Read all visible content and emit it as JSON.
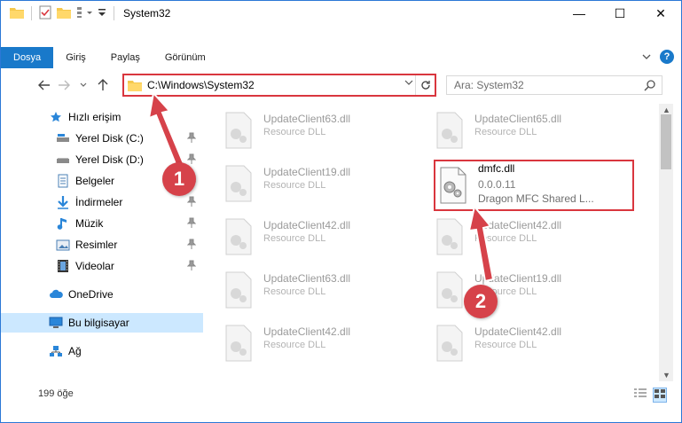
{
  "window": {
    "title": "System32",
    "controls": {
      "minimize": "—",
      "maximize": "☐",
      "close": "✕"
    }
  },
  "ribbon": {
    "tabs": [
      {
        "label": "Dosya",
        "active": true
      },
      {
        "label": "Giriş"
      },
      {
        "label": "Paylaş"
      },
      {
        "label": "Görünüm"
      }
    ],
    "help": "?"
  },
  "navigation": {
    "address_path": "C:\\Windows\\System32",
    "search_placeholder": "Ara: System32"
  },
  "sidebar": {
    "items": [
      {
        "label": "Hızlı erişim",
        "icon": "star-icon"
      },
      {
        "label": "Yerel Disk (C:)",
        "icon": "drive-icon",
        "pinned": true
      },
      {
        "label": "Yerel Disk (D:)",
        "icon": "drive-icon",
        "pinned": true
      },
      {
        "label": "Belgeler",
        "icon": "documents-icon",
        "pinned": true
      },
      {
        "label": "İndirmeler",
        "icon": "download-icon",
        "pinned": true
      },
      {
        "label": "Müzik",
        "icon": "music-icon",
        "pinned": true
      },
      {
        "label": "Resimler",
        "icon": "pictures-icon",
        "pinned": true
      },
      {
        "label": "Videolar",
        "icon": "videos-icon",
        "pinned": true
      },
      {
        "label": "OneDrive",
        "icon": "cloud-icon"
      },
      {
        "label": "Bu bilgisayar",
        "icon": "computer-icon",
        "selected": true
      },
      {
        "label": "Ağ",
        "icon": "network-icon"
      }
    ]
  },
  "files": [
    {
      "name": "UpdateClient63.dll",
      "desc": "Resource DLL"
    },
    {
      "name": "UpdateClient65.dll",
      "desc": "Resource DLL"
    },
    {
      "name": "UpdateClient19.dll",
      "desc": "Resource DLL"
    },
    {
      "name": "dmfc.dll",
      "version": "0.0.0.11",
      "desc": "Dragon MFC Shared L...",
      "highlighted": true
    },
    {
      "name": "UpdateClient42.dll",
      "desc": "Resource DLL"
    },
    {
      "name": "UpdateClient42.dll",
      "desc": "Resource DLL"
    },
    {
      "name": "UpdateClient63.dll",
      "desc": "Resource DLL"
    },
    {
      "name": "UpdateClient19.dll",
      "desc": "Resource DLL"
    },
    {
      "name": "UpdateClient42.dll",
      "desc": "Resource DLL"
    },
    {
      "name": "UpdateClient42.dll",
      "desc": "Resource DLL"
    }
  ],
  "status": {
    "item_count": "199 öğe"
  },
  "annotations": {
    "step1": "1",
    "step2": "2",
    "color": "#d6424a"
  }
}
